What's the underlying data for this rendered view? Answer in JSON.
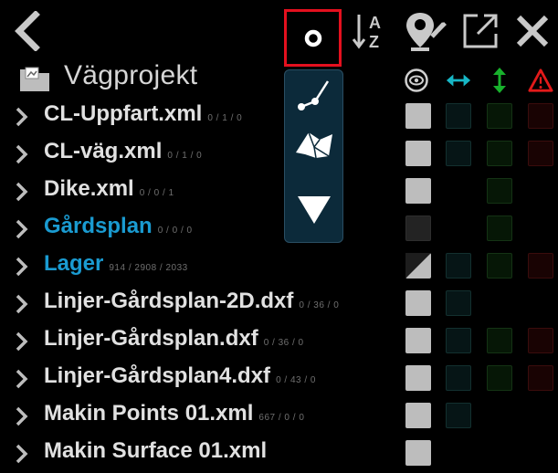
{
  "folder": {
    "title": "Vägprojekt"
  },
  "rows": [
    {
      "name": "CL-Uppfart.xml",
      "counts": "0 / 1 / 0"
    },
    {
      "name": "CL-väg.xml",
      "counts": "0 / 1 / 0"
    },
    {
      "name": "Dike.xml",
      "counts": "0 / 0 / 1"
    },
    {
      "name": "Gårdsplan",
      "counts": "0 / 0 / 0"
    },
    {
      "name": "Lager",
      "counts": "914 / 2908 / 2033"
    },
    {
      "name": "Linjer-Gårdsplan-2D.dxf",
      "counts": "0 / 36 / 0"
    },
    {
      "name": "Linjer-Gårdsplan.dxf",
      "counts": "0 / 36 / 0"
    },
    {
      "name": "Linjer-Gårdsplan4.dxf",
      "counts": "0 / 43 / 0"
    },
    {
      "name": "Makin Points 01.xml",
      "counts": "667 / 0 / 0"
    },
    {
      "name": "Makin Surface 01.xml",
      "counts": ""
    }
  ],
  "colors": {
    "folder_blue": "#1a9bd1",
    "selection_red": "#e4101e",
    "popup_bg": "#0c2a3a",
    "accent_cyan": "#17b7c6",
    "accent_green": "#18b12c",
    "accent_red": "#e21a1a"
  },
  "icons": {
    "back": "chevron-left-icon",
    "point_filter": "point-icon",
    "sort": "sort-az-icon",
    "edit_location": "edit-location-icon",
    "open_external": "open-external-icon",
    "close": "close-icon",
    "folder": "folder-image-icon",
    "visibility": "eye-icon",
    "horizontal": "arrows-horizontal-icon",
    "vertical": "arrows-vertical-icon",
    "warning": "warning-icon",
    "popup_line": "line-icon",
    "popup_surface": "surface-icon",
    "popup_triangle": "triangle-icon"
  }
}
